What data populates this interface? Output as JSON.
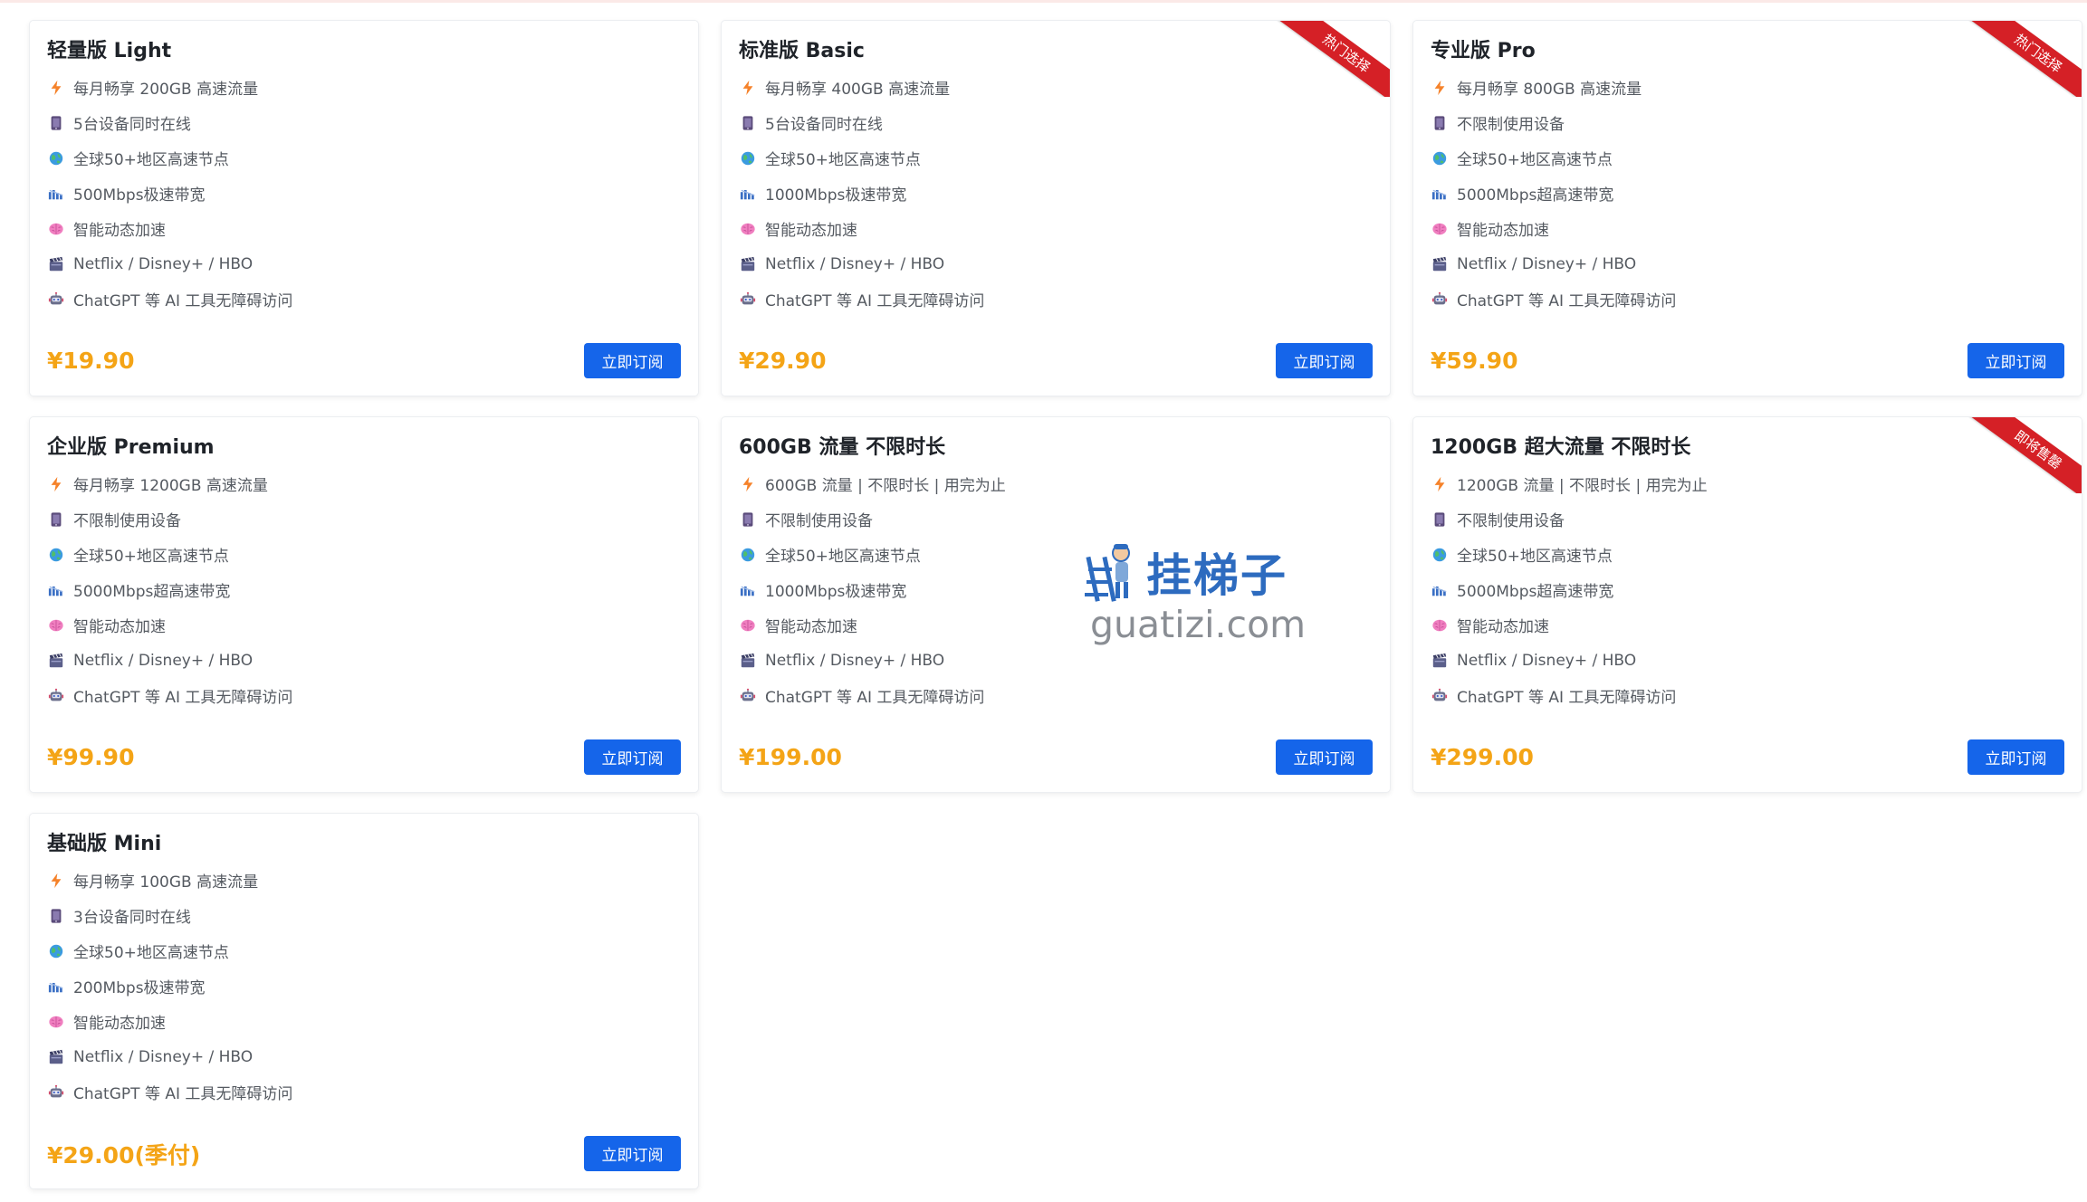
{
  "plans": [
    {
      "title": "轻量版 Light",
      "price": "¥19.90",
      "button_label": "立即订阅",
      "ribbon": null,
      "features": [
        {
          "icon": "lightning-icon",
          "text": "每月畅享 200GB 高速流量"
        },
        {
          "icon": "device-icon",
          "text": "5台设备同时在线"
        },
        {
          "icon": "globe-icon",
          "text": "全球50+地区高速节点"
        },
        {
          "icon": "speed-icon",
          "text": "500Mbps极速带宽"
        },
        {
          "icon": "brain-icon",
          "text": "智能动态加速"
        },
        {
          "icon": "clapper-icon",
          "text": "Netflix / Disney+ / HBO"
        },
        {
          "icon": "robot-icon",
          "text": "ChatGPT 等 AI 工具无障碍访问"
        }
      ]
    },
    {
      "title": "标准版 Basic",
      "price": "¥29.90",
      "button_label": "立即订阅",
      "ribbon": "热门选择",
      "features": [
        {
          "icon": "lightning-icon",
          "text": "每月畅享 400GB 高速流量"
        },
        {
          "icon": "device-icon",
          "text": "5台设备同时在线"
        },
        {
          "icon": "globe-icon",
          "text": "全球50+地区高速节点"
        },
        {
          "icon": "speed-icon",
          "text": "1000Mbps极速带宽"
        },
        {
          "icon": "brain-icon",
          "text": "智能动态加速"
        },
        {
          "icon": "clapper-icon",
          "text": "Netflix / Disney+ / HBO"
        },
        {
          "icon": "robot-icon",
          "text": "ChatGPT 等 AI 工具无障碍访问"
        }
      ]
    },
    {
      "title": "专业版 Pro",
      "price": "¥59.90",
      "button_label": "立即订阅",
      "ribbon": "热门选择",
      "features": [
        {
          "icon": "lightning-icon",
          "text": "每月畅享 800GB 高速流量"
        },
        {
          "icon": "device-icon",
          "text": "不限制使用设备"
        },
        {
          "icon": "globe-icon",
          "text": "全球50+地区高速节点"
        },
        {
          "icon": "speed-icon",
          "text": "5000Mbps超高速带宽"
        },
        {
          "icon": "brain-icon",
          "text": "智能动态加速"
        },
        {
          "icon": "clapper-icon",
          "text": "Netflix / Disney+ / HBO"
        },
        {
          "icon": "robot-icon",
          "text": "ChatGPT 等 AI 工具无障碍访问"
        }
      ]
    },
    {
      "title": "企业版 Premium",
      "price": "¥99.90",
      "button_label": "立即订阅",
      "ribbon": null,
      "features": [
        {
          "icon": "lightning-icon",
          "text": "每月畅享 1200GB 高速流量"
        },
        {
          "icon": "device-icon",
          "text": "不限制使用设备"
        },
        {
          "icon": "globe-icon",
          "text": "全球50+地区高速节点"
        },
        {
          "icon": "speed-icon",
          "text": "5000Mbps超高速带宽"
        },
        {
          "icon": "brain-icon",
          "text": "智能动态加速"
        },
        {
          "icon": "clapper-icon",
          "text": "Netflix / Disney+ / HBO"
        },
        {
          "icon": "robot-icon",
          "text": "ChatGPT 等 AI 工具无障碍访问"
        }
      ]
    },
    {
      "title": "600GB 流量 不限时长",
      "price": "¥199.00",
      "button_label": "立即订阅",
      "ribbon": null,
      "features": [
        {
          "icon": "lightning-icon",
          "text": "600GB 流量 | 不限时长 | 用完为止"
        },
        {
          "icon": "device-icon",
          "text": "不限制使用设备"
        },
        {
          "icon": "globe-icon",
          "text": "全球50+地区高速节点"
        },
        {
          "icon": "speed-icon",
          "text": "1000Mbps极速带宽"
        },
        {
          "icon": "brain-icon",
          "text": "智能动态加速"
        },
        {
          "icon": "clapper-icon",
          "text": "Netflix / Disney+ / HBO"
        },
        {
          "icon": "robot-icon",
          "text": "ChatGPT 等 AI 工具无障碍访问"
        }
      ]
    },
    {
      "title": "1200GB 超大流量 不限时长",
      "price": "¥299.00",
      "button_label": "立即订阅",
      "ribbon": "即将售罄",
      "features": [
        {
          "icon": "lightning-icon",
          "text": "1200GB 流量 | 不限时长 | 用完为止"
        },
        {
          "icon": "device-icon",
          "text": "不限制使用设备"
        },
        {
          "icon": "globe-icon",
          "text": "全球50+地区高速节点"
        },
        {
          "icon": "speed-icon",
          "text": "5000Mbps超高速带宽"
        },
        {
          "icon": "brain-icon",
          "text": "智能动态加速"
        },
        {
          "icon": "clapper-icon",
          "text": "Netflix / Disney+ / HBO"
        },
        {
          "icon": "robot-icon",
          "text": "ChatGPT 等 AI 工具无障碍访问"
        }
      ]
    },
    {
      "title": "基础版 Mini",
      "price": "¥29.00(季付)",
      "button_label": "立即订阅",
      "ribbon": null,
      "features": [
        {
          "icon": "lightning-icon",
          "text": "每月畅享 100GB 高速流量"
        },
        {
          "icon": "device-icon",
          "text": "3台设备同时在线"
        },
        {
          "icon": "globe-icon",
          "text": "全球50+地区高速节点"
        },
        {
          "icon": "speed-icon",
          "text": "200Mbps极速带宽"
        },
        {
          "icon": "brain-icon",
          "text": "智能动态加速"
        },
        {
          "icon": "clapper-icon",
          "text": "Netflix / Disney+ / HBO"
        },
        {
          "icon": "robot-icon",
          "text": "ChatGPT 等 AI 工具无障碍访问"
        }
      ]
    }
  ],
  "watermark": {
    "title": "挂梯子",
    "domain": "guatizi.com"
  },
  "colors": {
    "price": "#f4a416",
    "button": "#1565ea",
    "ribbon": "#d52026",
    "watermark_title": "#2d6bbf"
  }
}
